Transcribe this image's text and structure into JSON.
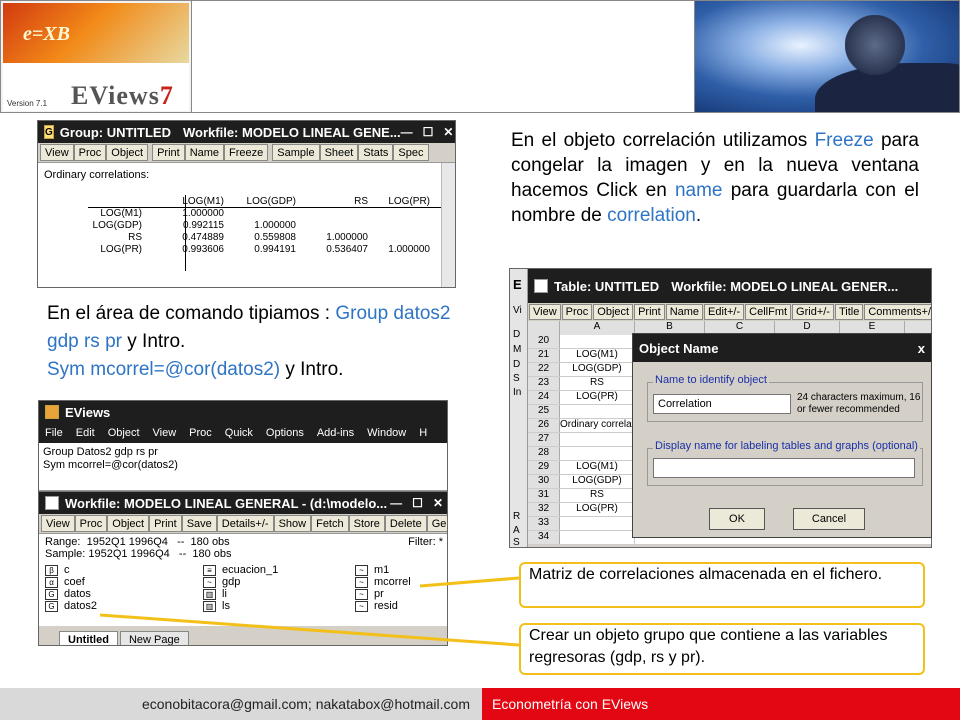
{
  "header": {
    "logo_text": "EViews",
    "logo_number": "7",
    "logo_version": "Version 7.1"
  },
  "group_window": {
    "icon": "G",
    "title": "Group: UNTITLED",
    "workfile": "Workfile: MODELO LINEAL GENE...",
    "controls": [
      "—",
      "☐",
      "✕"
    ],
    "toolbar": [
      "View",
      "Proc",
      "Object",
      "Print",
      "Name",
      "Freeze",
      "Sample",
      "Sheet",
      "Stats",
      "Spec"
    ],
    "heading": "Ordinary correlations:",
    "columns": [
      "",
      "LOG(M1)",
      "LOG(GDP)",
      "RS",
      "LOG(PR)"
    ],
    "rows": [
      [
        "LOG(M1)",
        "1.000000",
        "",
        "",
        ""
      ],
      [
        "LOG(GDP)",
        "0.992115",
        "1.000000",
        "",
        ""
      ],
      [
        "RS",
        "0.474889",
        "0.559808",
        "1.000000",
        ""
      ],
      [
        "LOG(PR)",
        "0.993606",
        "0.994191",
        "0.536407",
        "1.000000"
      ]
    ]
  },
  "text_right": {
    "p1": "En el objeto correlación utilizamos",
    "freeze": "Freeze",
    "p2": " para congelar la imagen y en la nueva ventana hacemos Click en ",
    "name": "name",
    "p3": " para guardarla con el nombre de ",
    "correlation": "correlation",
    "p4": "."
  },
  "text_left": {
    "p1": "En el área de comando tipiamos : ",
    "group_cmd": "Group datos2 gdp rs pr",
    "p2": "  y Intro.",
    "sym_cmd": "Sym mcorrel=@cor(datos2)",
    "p3": "  y Intro."
  },
  "table_window": {
    "title": "Table: UNTITLED",
    "workfile": "Workfile: MODELO LINEAL GENER...",
    "toolbar": [
      "View",
      "Proc",
      "Object",
      "Print",
      "Name",
      "Edit+/-",
      "CellFmt",
      "Grid+/-",
      "Title",
      "Comments+/-"
    ],
    "col_headers": [
      "",
      "A",
      "B",
      "C",
      "D",
      "E"
    ],
    "left_strip": [
      "E",
      "Vi",
      "D",
      "M",
      "D",
      "S",
      "In",
      "R",
      "A",
      "S"
    ],
    "rows": [
      {
        "n": "20",
        "a": ""
      },
      {
        "n": "21",
        "a": "LOG(M1)"
      },
      {
        "n": "22",
        "a": "LOG(GDP)"
      },
      {
        "n": "23",
        "a": "RS"
      },
      {
        "n": "24",
        "a": "LOG(PR)"
      },
      {
        "n": "25",
        "a": ""
      },
      {
        "n": "26",
        "a": "Ordinary correlat"
      },
      {
        "n": "27",
        "a": ""
      },
      {
        "n": "28",
        "a": ""
      },
      {
        "n": "29",
        "a": "LOG(M1)"
      },
      {
        "n": "30",
        "a": "LOG(GDP)"
      },
      {
        "n": "31",
        "a": "RS"
      },
      {
        "n": "32",
        "a": "LOG(PR)"
      },
      {
        "n": "33",
        "a": ""
      },
      {
        "n": "34",
        "a": ""
      }
    ]
  },
  "object_name_dialog": {
    "title": "Object Name",
    "close": "x",
    "name_label": "Name to identify object",
    "name_value": "Correlation",
    "name_hint": "24 characters maximum, 16 or fewer recommended",
    "display_label": "Display name for labeling tables and graphs (optional)",
    "display_value": "",
    "ok": "OK",
    "cancel": "Cancel"
  },
  "eviews_window": {
    "title": "EViews",
    "menu": [
      "File",
      "Edit",
      "Object",
      "View",
      "Proc",
      "Quick",
      "Options",
      "Add-ins",
      "Window",
      "H"
    ],
    "command_lines": [
      "Group Datos2 gdp rs pr",
      "Sym mcorrel=@cor(datos2)"
    ]
  },
  "workfile_window": {
    "title": "Workfile: MODELO LINEAL GENERAL - (d:\\modelo...",
    "controls": [
      "—",
      "☐",
      "✕"
    ],
    "toolbar": [
      "View",
      "Proc",
      "Object",
      "Print",
      "Save",
      "Details+/-",
      "Show",
      "Fetch",
      "Store",
      "Delete",
      "Ger"
    ],
    "range": "Range:  1952Q1 1996Q4   --  180 obs",
    "sample": "Sample: 1952Q1 1996Q4   --  180 obs",
    "filter": "Filter: *",
    "objects_col1": [
      {
        "icon": "β",
        "name": "c"
      },
      {
        "icon": "α",
        "name": "coef"
      },
      {
        "icon": "G",
        "name": "datos"
      },
      {
        "icon": "G",
        "name": "datos2"
      }
    ],
    "objects_col2": [
      {
        "icon": "≡",
        "name": "ecuacion_1"
      },
      {
        "icon": "~",
        "name": "gdp"
      },
      {
        "icon": "▥",
        "name": "li"
      },
      {
        "icon": "▥",
        "name": "ls"
      }
    ],
    "objects_col3": [
      {
        "icon": "~",
        "name": "m1"
      },
      {
        "icon": "~",
        "name": "mcorrel"
      },
      {
        "icon": "~",
        "name": "pr"
      },
      {
        "icon": "~",
        "name": "resid"
      }
    ],
    "tabs": [
      "Untitled",
      "New Page"
    ]
  },
  "callouts": {
    "c1": "Matriz de correlaciones almacenada en el fichero.",
    "c2": "Crear un objeto grupo que contiene a las variables regresoras (gdp, rs y pr)."
  },
  "footer": {
    "left": "econobitacora@gmail.com;  nakatabox@hotmail.com",
    "right": "Econometría con EViews"
  },
  "colors": {
    "accent_blue": "#2e74c5",
    "callout_border": "#f2c019",
    "footer_red": "#e30613"
  }
}
